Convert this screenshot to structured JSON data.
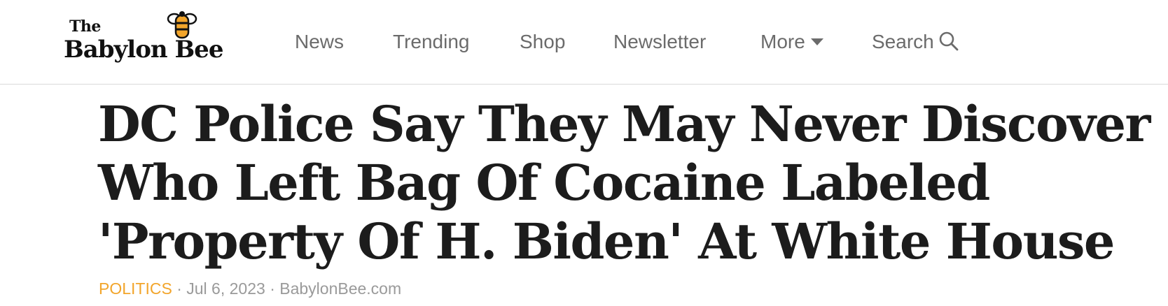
{
  "brand": {
    "logo_line1": "The",
    "logo_line2": "Babylon Bee",
    "bee_icon": "bee-icon",
    "accent_color": "#f2a52b"
  },
  "nav": {
    "items": [
      {
        "label": "News"
      },
      {
        "label": "Trending"
      },
      {
        "label": "Shop"
      },
      {
        "label": "Newsletter"
      },
      {
        "label": "More",
        "icon": "caret-down-icon"
      },
      {
        "label": "Search",
        "icon": "search-icon"
      }
    ]
  },
  "article": {
    "headline_lines": [
      "DC Police Say They May Never Discover",
      "Who Left Bag Of Cocaine Labeled",
      "'Property Of H. Biden' At White House"
    ],
    "category": "POLITICS",
    "separator": "·",
    "date": "Jul 6, 2023",
    "source": "BabylonBee.com"
  }
}
